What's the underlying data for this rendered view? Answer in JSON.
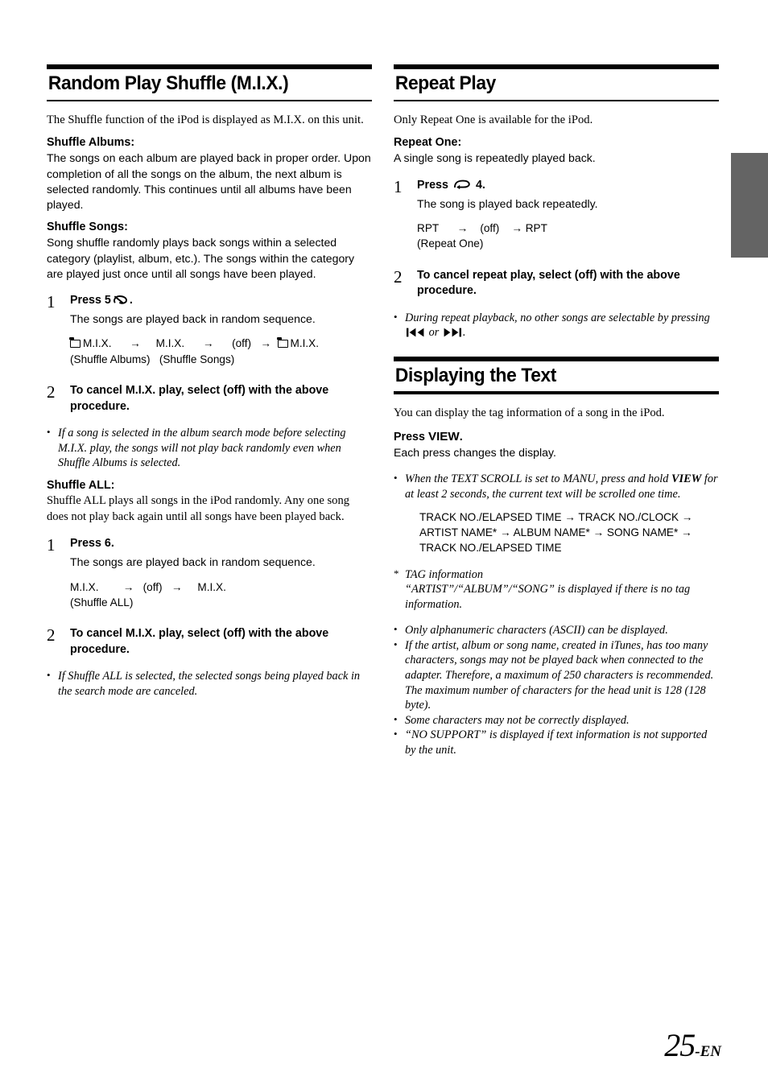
{
  "page": {
    "number": "25",
    "suffix": "-EN"
  },
  "left_column": {
    "section_title": "Random Play  Shuffle (M.I.X.)",
    "intro": "The Shuffle function of the iPod is displayed as M.I.X. on this unit.",
    "shuffle_albums": {
      "heading": "Shuffle Albums:",
      "body": "The songs on each album are played back in proper order. Upon completion of all the songs on the album, the next album is selected randomly. This continues until all albums have been played."
    },
    "shuffle_songs": {
      "heading": "Shuffle Songs:",
      "body": "Song shuffle randomly plays back songs within a selected category (playlist, album, etc.). The songs within the category are played just once until all songs have been played."
    },
    "step1": {
      "number": "1",
      "title_pre": "Press 5",
      "title_post": ".",
      "icon": "shuffle-icon",
      "desc": "The songs are played back in random sequence.",
      "flow": {
        "item1": "M.I.X.",
        "arrow1": "→",
        "item2": "M.I.X.",
        "arrow2": "→",
        "item3": "(off)",
        "arrow3": "→",
        "item4": "M.I.X.",
        "sub1": "(Shuffle Albums)",
        "sub2": "(Shuffle Songs)"
      }
    },
    "step2": {
      "number": "2",
      "title": "To cancel M.I.X. play, select (off) with the above procedure."
    },
    "note1": "If a song is selected in the album search mode before selecting M.I.X. play, the songs will not play back randomly even when Shuffle Albums is selected.",
    "shuffle_all": {
      "heading": "Shuffle ALL:",
      "body": "Shuffle ALL plays all songs in the iPod randomly. Any one song does not play back again until all songs have been played back."
    },
    "step3": {
      "number": "1",
      "title": "Press 6.",
      "desc": "The songs are played back in random sequence.",
      "flow": {
        "item1": "M.I.X.",
        "arrow1": "→",
        "item2": "(off)",
        "arrow2": "→",
        "item3": "M.I.X.",
        "sub1": "(Shuffle ALL)"
      }
    },
    "step4": {
      "number": "2",
      "title": "To cancel M.I.X. play, select (off) with the above procedure."
    },
    "note2": "If Shuffle ALL is selected, the selected songs being played back in the search mode are canceled."
  },
  "right_column": {
    "repeat": {
      "section_title": "Repeat Play",
      "intro": "Only Repeat One is available for the iPod.",
      "repeat_one": {
        "heading": "Repeat One:",
        "body": "A single song is repeatedly played back."
      },
      "step1": {
        "number": "1",
        "title_pre": "Press",
        "title_post": "4.",
        "icon": "repeat-icon",
        "desc": "The song is played back repeatedly.",
        "flow": {
          "item1": "RPT",
          "arrow1": "→",
          "item2": "(off)",
          "arrow2": "→",
          "item3": "RPT",
          "sub1": "(Repeat One)"
        }
      },
      "step2": {
        "number": "2",
        "title": "To cancel repeat play, select (off) with the above procedure."
      },
      "note": {
        "text_pre": "During repeat playback, no other songs are selectable by pressing",
        "icon_prev": "previous-track-icon",
        "conjunction": "or",
        "icon_next": "next-track-icon",
        "text_post": "."
      }
    },
    "text_display": {
      "section_title": "Displaying the Text",
      "intro": "You can display the tag information of a song in the iPod.",
      "press_heading_pre": "Press ",
      "press_heading_key": "VIEW",
      "press_heading_post": ".",
      "press_sub": "Each press changes the display.",
      "note_scroll": {
        "part1": "When the TEXT SCROLL is set to MANU, press and hold ",
        "key": "VIEW",
        "part2": " for at least 2 seconds, the current text will be scrolled one time."
      },
      "flow_lines": [
        "TRACK NO./ELAPSED TIME → TRACK NO./CLOCK →",
        "ARTIST NAME* → ALBUM NAME* → SONG NAME* →",
        "TRACK NO./ELAPSED TIME"
      ],
      "tag_note": {
        "marker": "*",
        "line1": "TAG information",
        "line2": "“ARTIST”/“ALBUM”/“SONG” is displayed if there is no tag information."
      },
      "notes": [
        "Only alphanumeric characters (ASCII) can be displayed.",
        "If the artist, album or song name, created in iTunes, has too many characters, songs may not be played back when connected to the adapter. Therefore, a maximum of 250 characters is recommended. The maximum number of characters for the head unit is 128 (128 byte).",
        "Some characters may not be correctly displayed.",
        "“NO SUPPORT” is displayed if text information is not supported by the unit."
      ]
    }
  },
  "colors": {
    "text": "#000000",
    "background": "#ffffff",
    "thumb_tab": "#646464"
  }
}
